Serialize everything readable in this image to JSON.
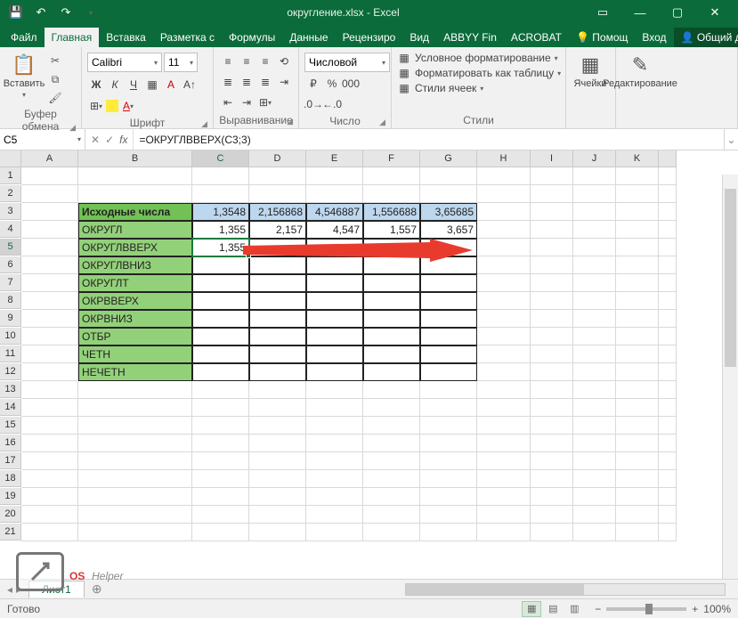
{
  "title": "округление.xlsx - Excel",
  "tabs": {
    "file": "Файл",
    "home": "Главная",
    "insert": "Вставка",
    "layout": "Разметка с",
    "formulas": "Формулы",
    "data": "Данные",
    "review": "Рецензиро",
    "view": "Вид",
    "abbyy": "ABBYY Fin",
    "acrobat": "ACROBAT",
    "tell": "Помощ",
    "signin": "Вход",
    "share": "Общий доступ"
  },
  "ribbon": {
    "paste": "Вставить",
    "clipboard": "Буфер обмена",
    "font_name": "Calibri",
    "font_size": "11",
    "font": "Шрифт",
    "alignment": "Выравнивание",
    "number_format": "Числовой",
    "number": "Число",
    "cond_fmt": "Условное форматирование",
    "fmt_table": "Форматировать как таблицу",
    "cell_styles": "Стили ячеек",
    "styles": "Стили",
    "cells": "Ячейки",
    "editing": "Редактирование"
  },
  "namebox": "C5",
  "formula": "=ОКРУГЛВВЕРХ(C3;3)",
  "columns": [
    "A",
    "B",
    "C",
    "D",
    "E",
    "F",
    "G",
    "H",
    "I",
    "J",
    "K"
  ],
  "rows": [
    "1",
    "2",
    "3",
    "4",
    "5",
    "6",
    "7",
    "8",
    "9",
    "10",
    "11",
    "12",
    "13",
    "14",
    "15",
    "16",
    "17",
    "18",
    "19",
    "20",
    "21"
  ],
  "table": {
    "header": "Исходные числа",
    "labels": [
      "ОКРУГЛ",
      "ОКРУГЛВВЕРХ",
      "ОКРУГЛВНИЗ",
      "ОКРУГЛТ",
      "ОКРВВЕРХ",
      "ОКРВНИЗ",
      "ОТБР",
      "ЧЕТН",
      "НЕЧЕТН"
    ],
    "src": [
      "1,3548",
      "2,156868",
      "4,546887",
      "1,556688",
      "3,65685"
    ],
    "okrugl": [
      "1,355",
      "2,157",
      "4,547",
      "1,557",
      "3,657"
    ],
    "okruglvverh": [
      "1,355"
    ]
  },
  "sheet": "Лист1",
  "status": "Готово",
  "zoom": "100%",
  "watermark": {
    "a": "OS",
    "b": "Helper"
  }
}
